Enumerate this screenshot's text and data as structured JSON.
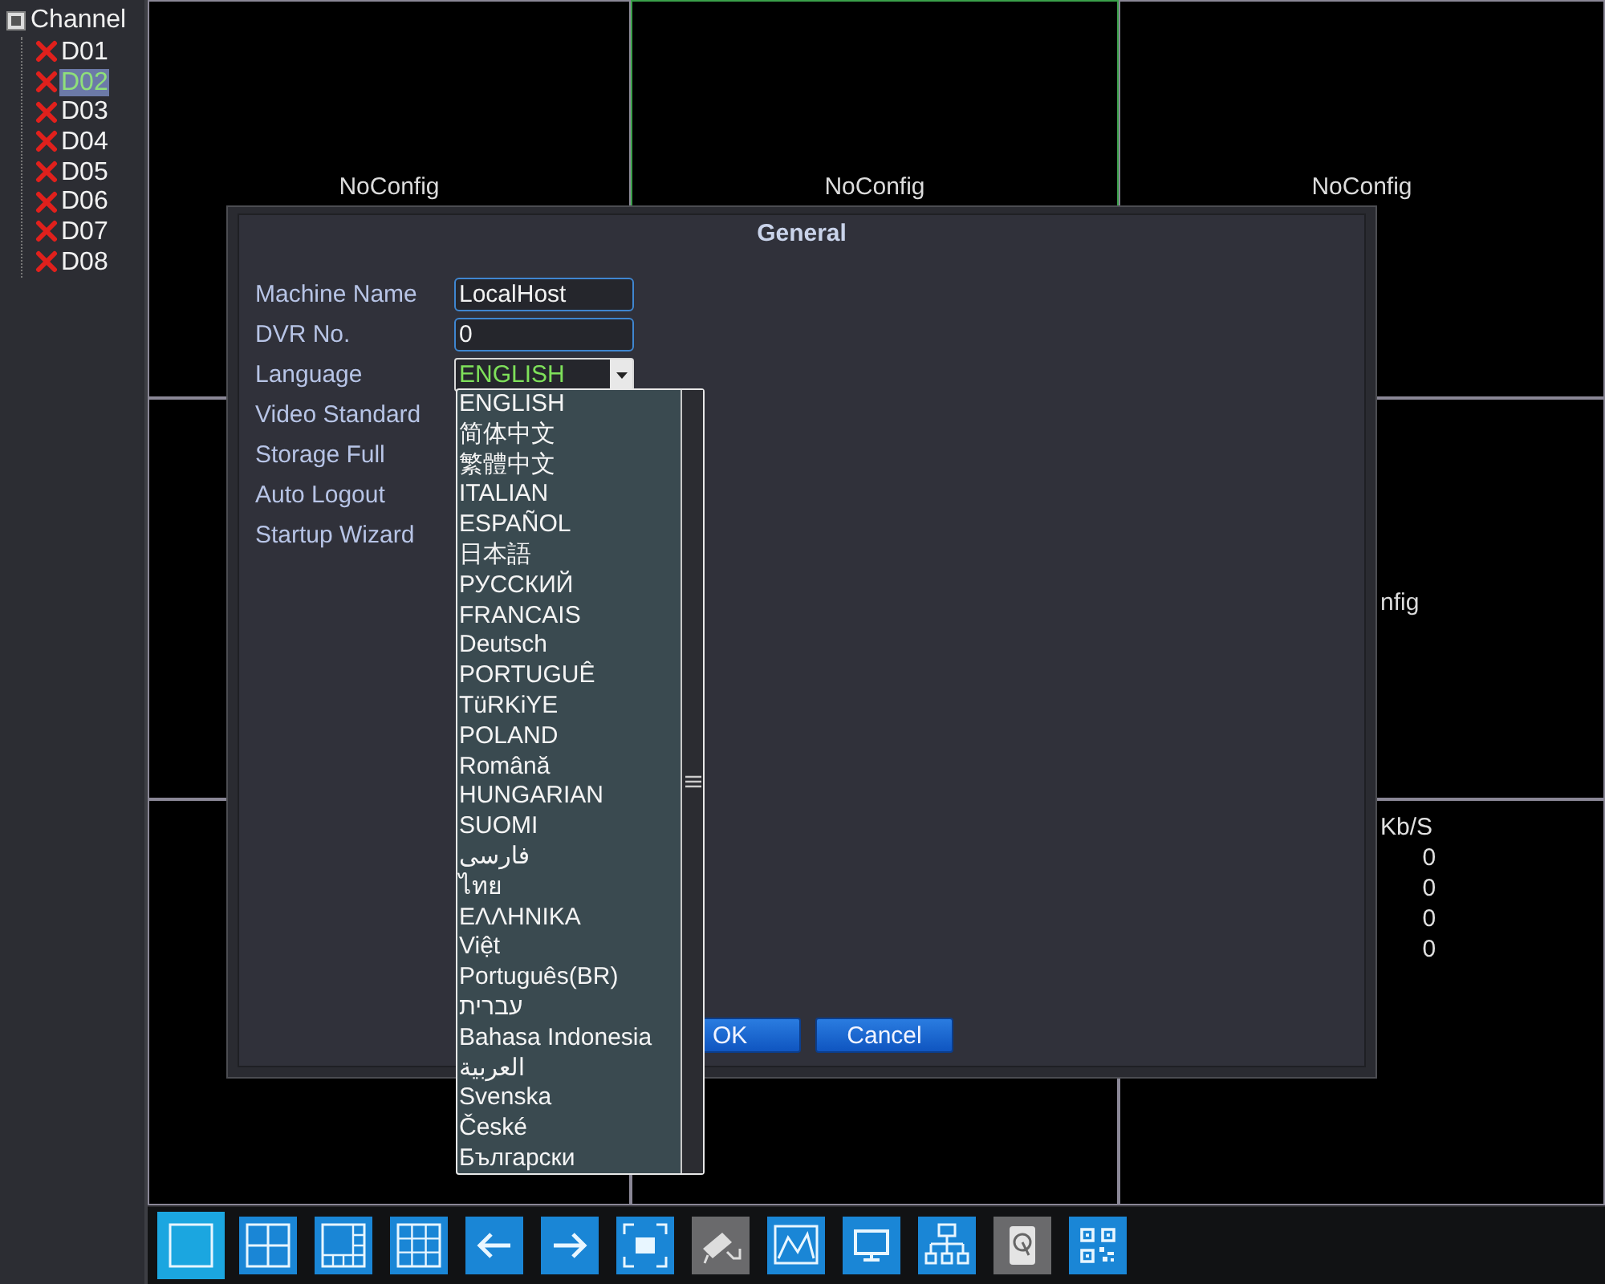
{
  "sidebar": {
    "title": "Channel",
    "items": [
      {
        "label": "D01",
        "selected": false
      },
      {
        "label": "D02",
        "selected": true
      },
      {
        "label": "D03",
        "selected": false
      },
      {
        "label": "D04",
        "selected": false
      },
      {
        "label": "D05",
        "selected": false
      },
      {
        "label": "D06",
        "selected": false
      },
      {
        "label": "D07",
        "selected": false
      },
      {
        "label": "D08",
        "selected": false
      }
    ]
  },
  "video_grid": {
    "cells": [
      {
        "selected": false,
        "label": "NoConfig"
      },
      {
        "selected": true,
        "label": "NoConfig"
      },
      {
        "selected": false,
        "label": "NoConfig"
      },
      {
        "selected": false
      },
      {},
      {
        "selected": false,
        "label": "nfig"
      },
      {
        "selected": false
      },
      {
        "selected": false
      },
      {
        "selected": false,
        "stats": {
          "header": "Kb/S",
          "values": [
            "0",
            "0",
            "0",
            "0"
          ]
        }
      }
    ]
  },
  "dialog": {
    "title": "General",
    "fields": [
      {
        "kind": "text",
        "label": "Machine Name",
        "value": "LocalHost"
      },
      {
        "kind": "text",
        "label": "DVR No.",
        "value": "0"
      },
      {
        "kind": "dropdown",
        "label": "Language",
        "value": "ENGLISH",
        "expanded": true,
        "options": [
          "ENGLISH",
          "简体中文",
          "繁體中文",
          "ITALIAN",
          "ESPAÑOL",
          "日本語",
          "РУССКИЙ",
          "FRANCAIS",
          "Deutsch",
          "PORTUGUÊ",
          "TüRKiYE",
          "POLAND",
          "Română",
          "HUNGARIAN",
          "SUOMI",
          "فارسی",
          "ไทย",
          "ΕΛΛΗΝΙΚΑ",
          "Việt",
          "Português(BR)",
          "עברית",
          "Bahasa Indonesia",
          "العربية",
          "Svenska",
          "České",
          "Български"
        ]
      },
      {
        "kind": "setting",
        "label": "Video Standard"
      },
      {
        "kind": "setting",
        "label": "Storage Full"
      },
      {
        "kind": "setting",
        "label": "Auto Logout"
      },
      {
        "kind": "setting",
        "label": "Startup Wizard"
      }
    ],
    "buttons": [
      "OK",
      "Cancel"
    ]
  },
  "toolbar": [
    {
      "kind": "single",
      "selected": true,
      "disabled": false
    },
    {
      "kind": "quad",
      "selected": false,
      "disabled": false
    },
    {
      "kind": "six",
      "selected": false,
      "disabled": false
    },
    {
      "kind": "nine",
      "selected": false,
      "disabled": false
    },
    {
      "kind": "prev",
      "selected": false,
      "disabled": false
    },
    {
      "kind": "next",
      "selected": false,
      "disabled": false
    },
    {
      "kind": "fullscreen",
      "selected": false,
      "disabled": false
    },
    {
      "kind": "camera",
      "selected": false,
      "disabled": true
    },
    {
      "kind": "chart",
      "selected": false,
      "disabled": false
    },
    {
      "kind": "monitor",
      "selected": false,
      "disabled": false
    },
    {
      "kind": "network",
      "selected": false,
      "disabled": false
    },
    {
      "kind": "disk",
      "selected": false,
      "disabled": true
    },
    {
      "kind": "qr",
      "selected": false,
      "disabled": false
    }
  ]
}
